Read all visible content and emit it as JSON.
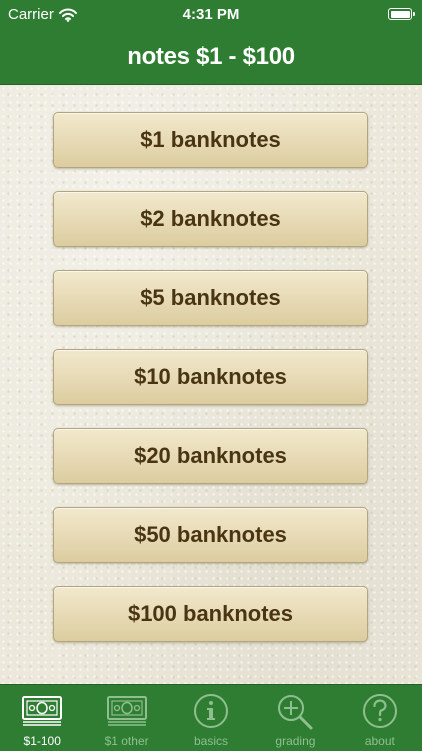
{
  "status_bar": {
    "carrier": "Carrier",
    "time": "4:31 PM"
  },
  "nav": {
    "title": "notes $1 - $100"
  },
  "buttons": [
    {
      "label": "$1 banknotes"
    },
    {
      "label": "$2 banknotes"
    },
    {
      "label": "$5 banknotes"
    },
    {
      "label": "$10 banknotes"
    },
    {
      "label": "$20 banknotes"
    },
    {
      "label": "$50 banknotes"
    },
    {
      "label": "$100 banknotes"
    }
  ],
  "tabs": [
    {
      "label": "$1-100",
      "icon": "banknote-icon",
      "active": true
    },
    {
      "label": "$1 other",
      "icon": "banknote-icon",
      "active": false
    },
    {
      "label": "basics",
      "icon": "info-icon",
      "active": false
    },
    {
      "label": "grading",
      "icon": "magnifier-plus-icon",
      "active": false
    },
    {
      "label": "about",
      "icon": "question-icon",
      "active": false
    }
  ],
  "colors": {
    "brand_green": "#2f7d32",
    "button_text": "#4a3512",
    "tab_inactive": "#8fbf8f",
    "tab_active": "#ffffff"
  }
}
